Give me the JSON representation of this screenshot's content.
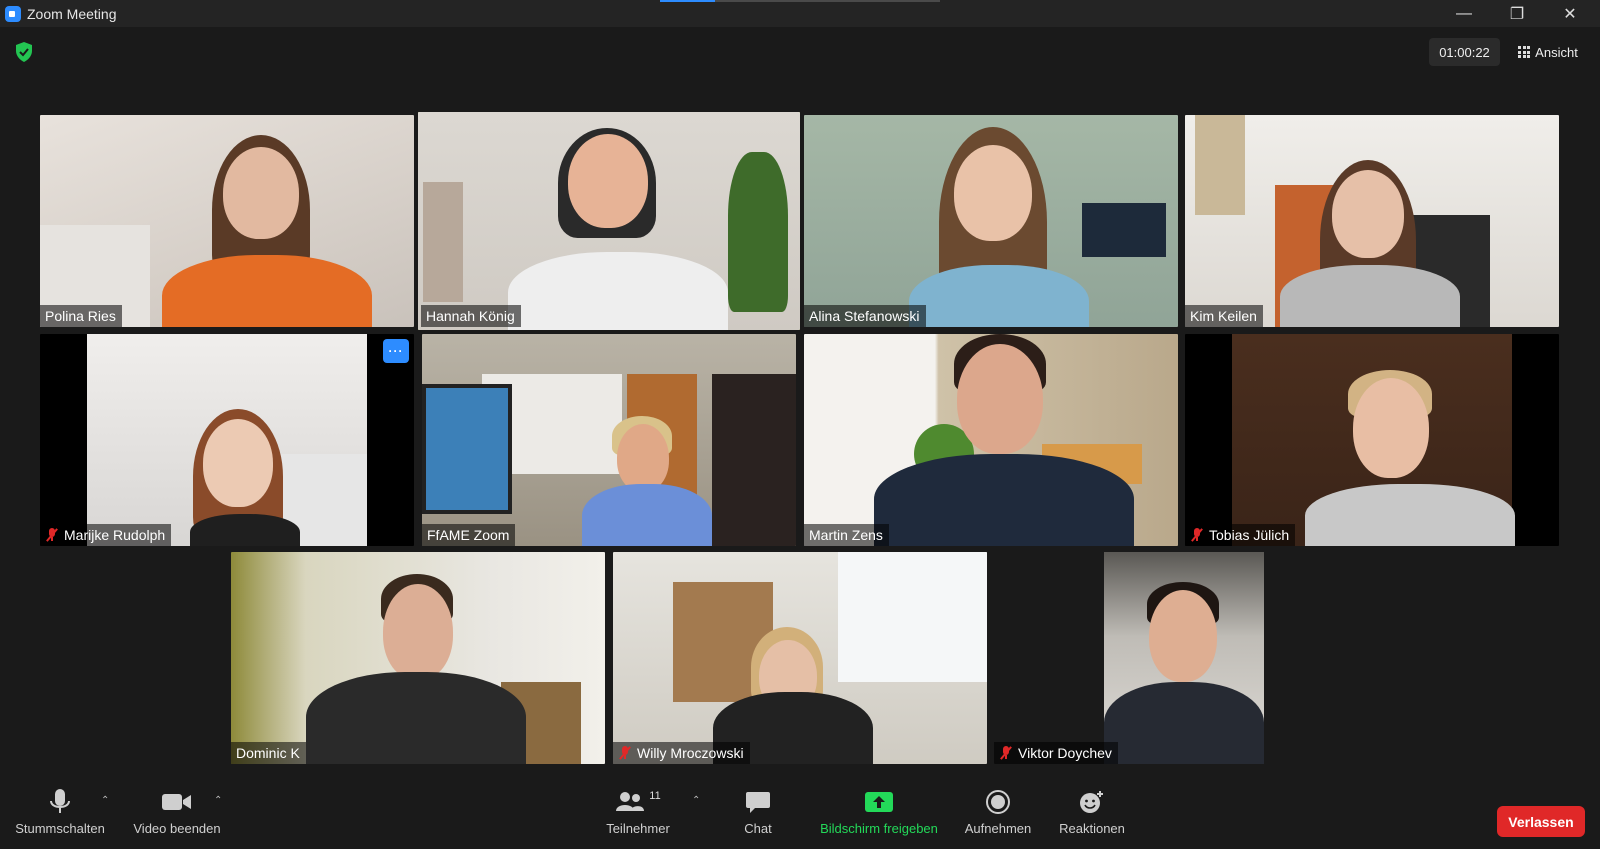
{
  "window": {
    "title": "Zoom Meeting"
  },
  "header": {
    "timer": "01:00:22",
    "view_label": "Ansicht"
  },
  "participants": [
    {
      "name": "Polina Ries",
      "muted": false
    },
    {
      "name": "Hannah König",
      "muted": false,
      "active": true
    },
    {
      "name": "Alina Stefanowski",
      "muted": false
    },
    {
      "name": "Kim Keilen",
      "muted": false
    },
    {
      "name": "Marijke Rudolph",
      "muted": true
    },
    {
      "name": "FfAME Zoom",
      "muted": false
    },
    {
      "name": "Martin Zens",
      "muted": false
    },
    {
      "name": "Tobias Jülich",
      "muted": true
    },
    {
      "name": "Dominic K",
      "muted": false
    },
    {
      "name": "Willy Mroczowski",
      "muted": true
    },
    {
      "name": "Viktor Doychev",
      "muted": true
    }
  ],
  "toolbar": {
    "mute_label": "Stummschalten",
    "video_label": "Video beenden",
    "participants_label": "Teilnehmer",
    "participants_count": "11",
    "chat_label": "Chat",
    "share_label": "Bildschirm freigeben",
    "record_label": "Aufnehmen",
    "reactions_label": "Reaktionen",
    "leave_label": "Verlassen"
  },
  "colors": {
    "accent": "#2d8cff",
    "share": "#23d959",
    "leave": "#e02828",
    "active_speaker": "#c6e04a"
  }
}
